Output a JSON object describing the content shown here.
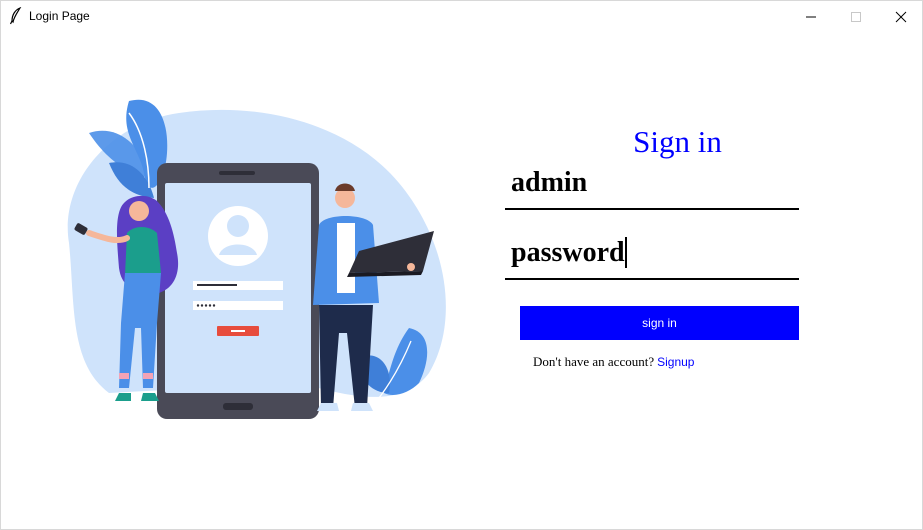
{
  "window": {
    "title": "Login Page",
    "controls": {
      "minimize_icon": "minimize-icon",
      "maximize_icon": "maximize-icon",
      "close_icon": "close-icon"
    }
  },
  "illustration": {
    "icon": "login-illustration",
    "colors": {
      "accent_blue": "#4b8fe8",
      "light_blue": "#cfe3fb",
      "phone_frame": "#4a4a57",
      "button_red": "#e74c3c"
    }
  },
  "form": {
    "title": "Sign in",
    "username": {
      "value": "admin"
    },
    "password": {
      "value": "password"
    },
    "signin_button": {
      "label": "sign in"
    },
    "signup": {
      "prompt": "Don't have an account?",
      "link_label": "Signup"
    }
  },
  "colors": {
    "primary": "#0000ff",
    "text": "#000000",
    "background": "#ffffff"
  }
}
